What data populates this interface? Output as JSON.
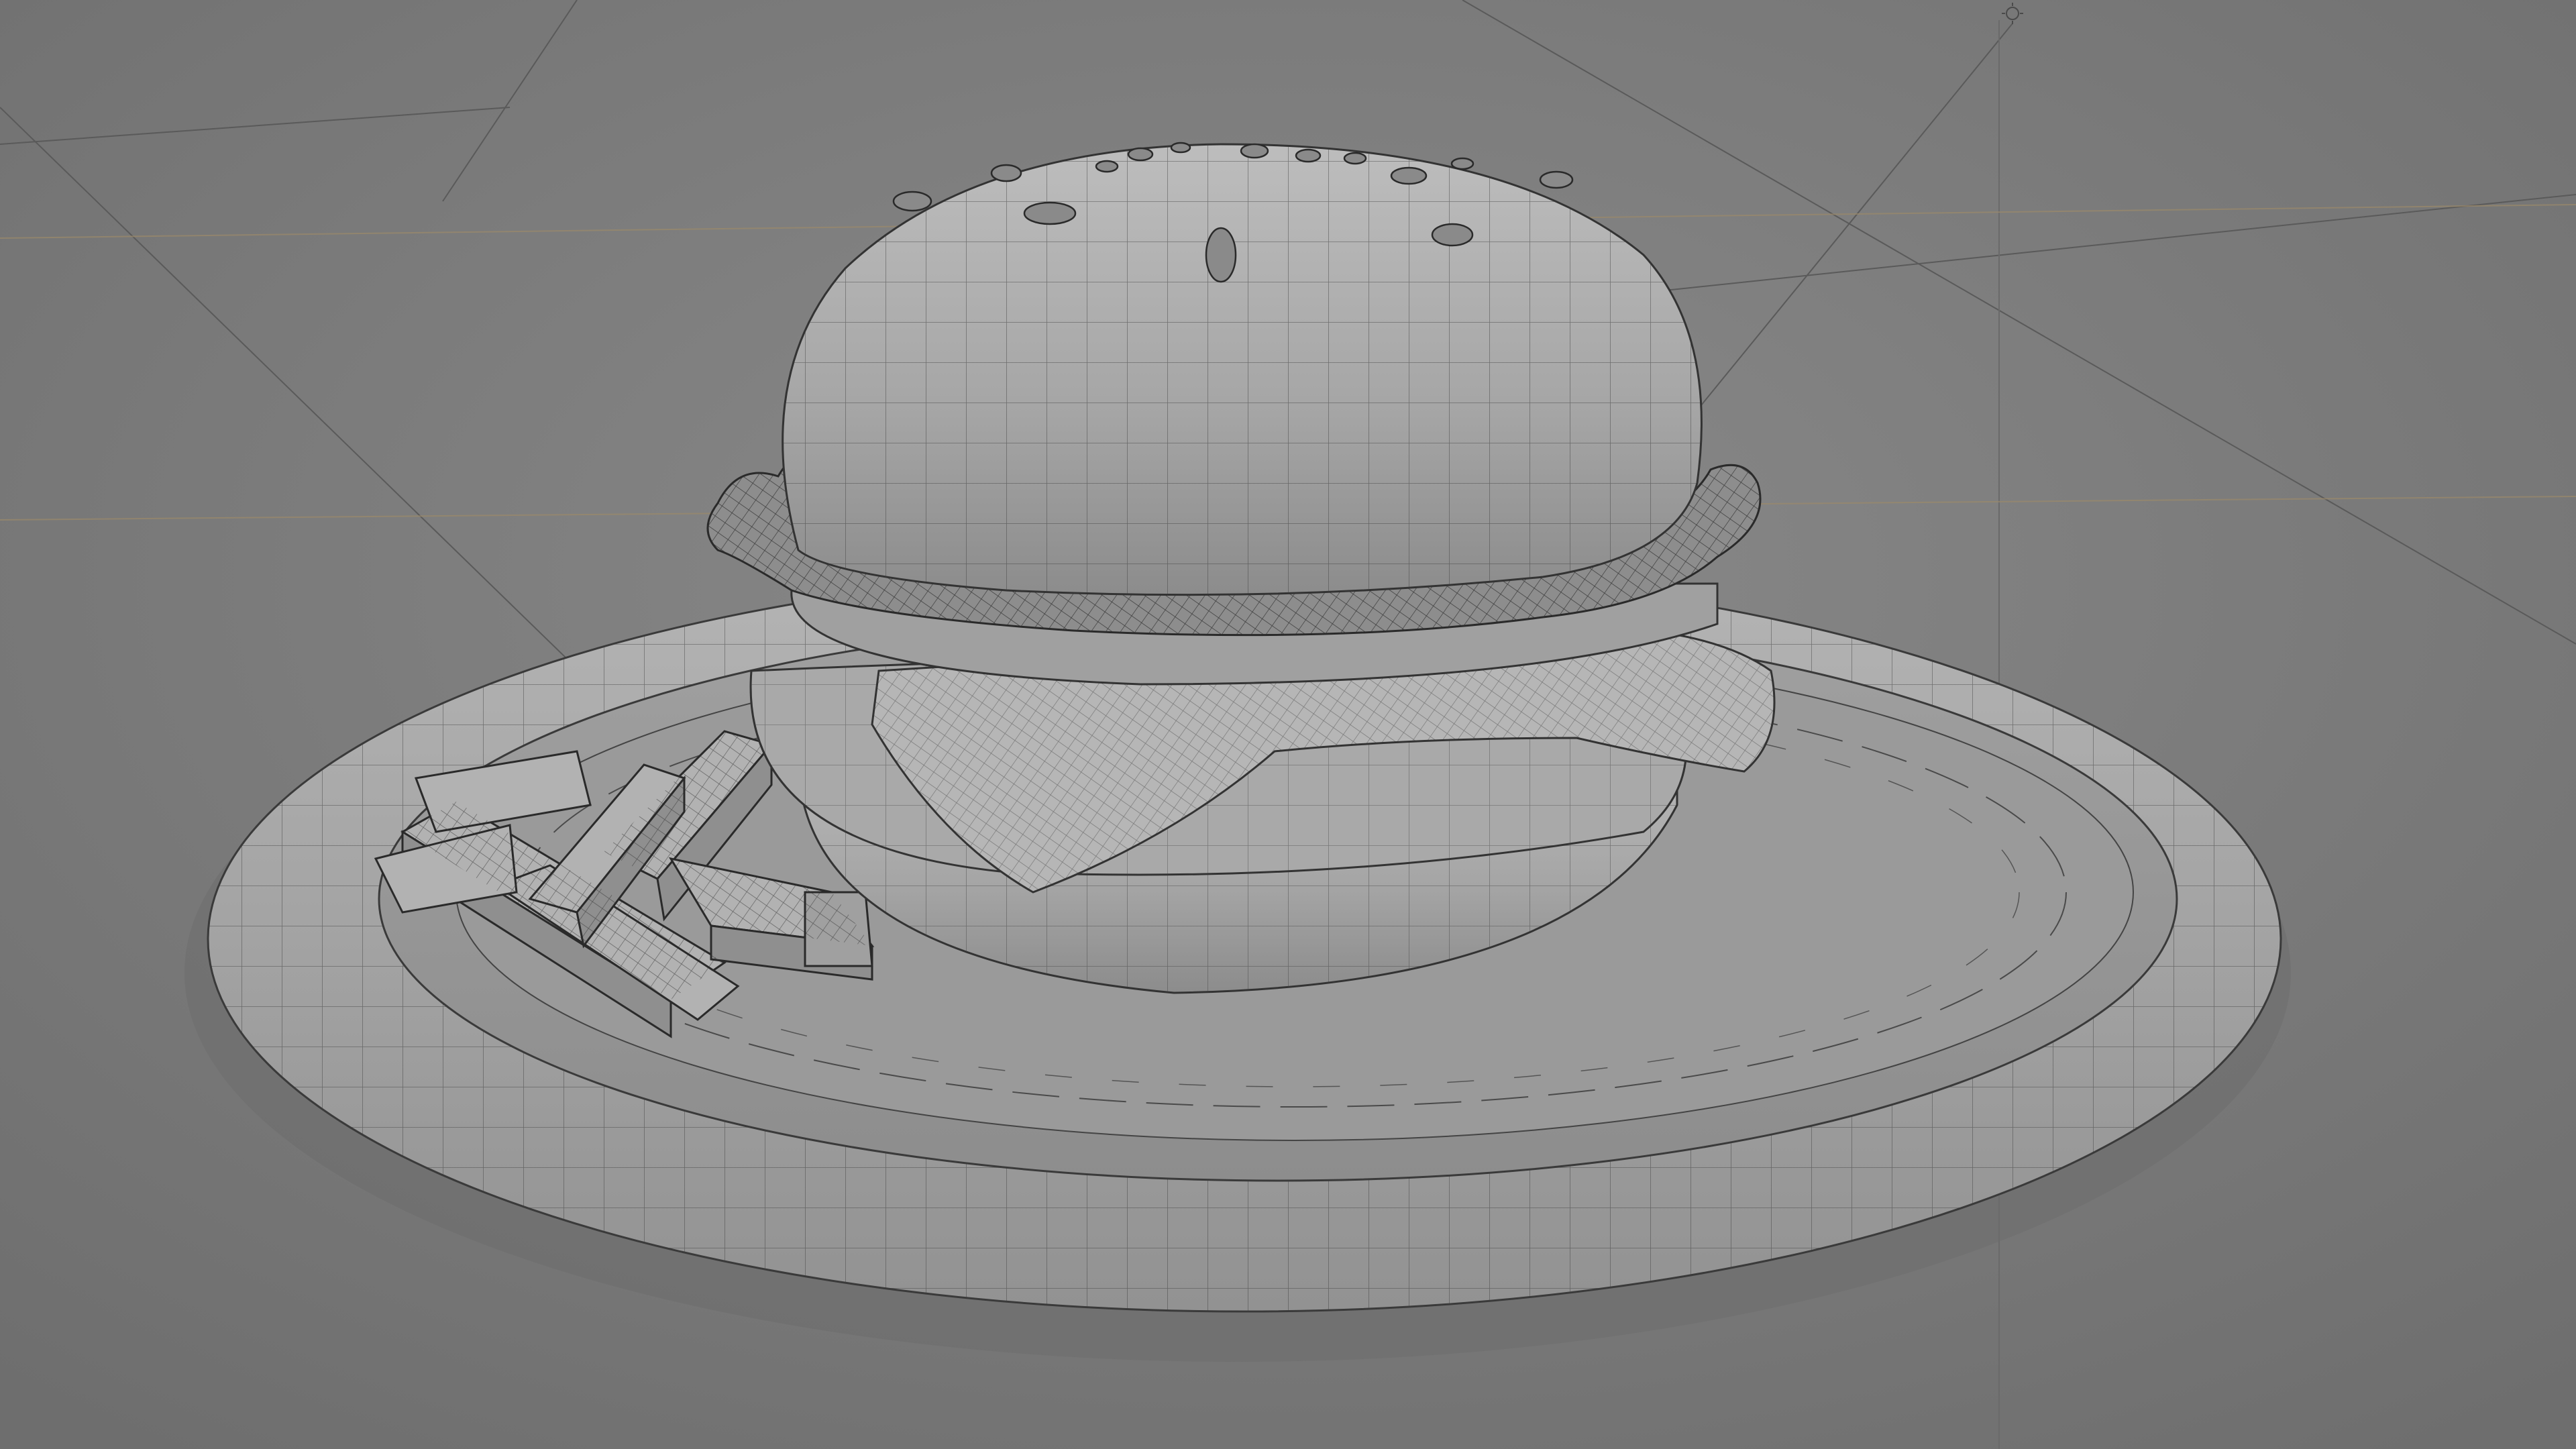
{
  "viewport": {
    "mode": "solid-wireframe-overlay",
    "background_color": "#7a7a7a",
    "grid_line_color": "#5e5e5e",
    "axis_line_color": "#9c8a6a",
    "mesh_fill_color": "#a8a8a8",
    "mesh_wire_color": "#3a3a3a"
  },
  "scene": {
    "objects": [
      {
        "name": "plate",
        "icon": "plate-mesh"
      },
      {
        "name": "burger-bun-top",
        "icon": "bun-mesh"
      },
      {
        "name": "sesame-seeds",
        "icon": "seed-mesh"
      },
      {
        "name": "lettuce",
        "icon": "lettuce-mesh"
      },
      {
        "name": "cheese-slice",
        "icon": "cheese-mesh"
      },
      {
        "name": "patty",
        "icon": "patty-mesh"
      },
      {
        "name": "burger-bun-bottom",
        "icon": "bun-mesh"
      },
      {
        "name": "french-fries",
        "icon": "fries-mesh"
      }
    ],
    "camera": {
      "icon": "camera-icon"
    },
    "light": {
      "icon": "light-icon"
    }
  }
}
